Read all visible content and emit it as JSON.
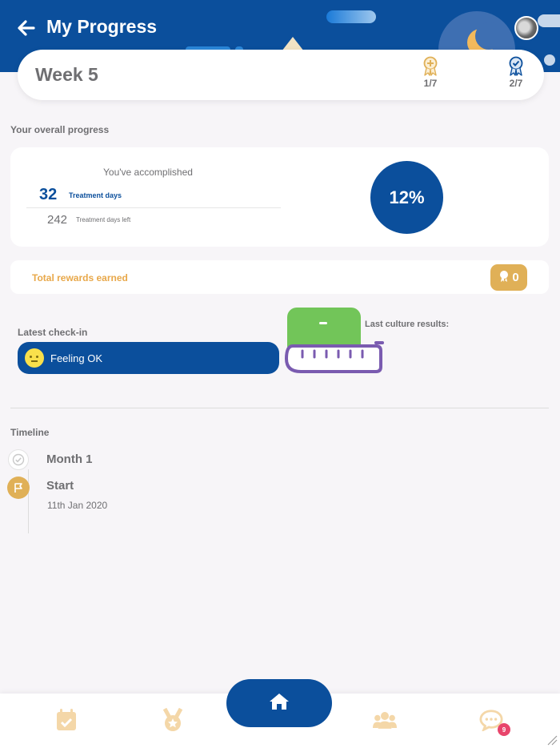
{
  "header": {
    "title": "My Progress"
  },
  "week": {
    "label": "Week 5",
    "badges": [
      {
        "icon": "award-ribbon-icon",
        "count": "1/7"
      },
      {
        "icon": "certificate-ribbon-icon",
        "count": "2/7"
      }
    ]
  },
  "overall": {
    "section_title": "Your overall progress",
    "accomplished_label": "You've accomplished",
    "treatment_days": "32",
    "treatment_days_label": "Treatment days",
    "days_left": "242",
    "days_left_label": "Treatment days left",
    "percent": "12%"
  },
  "rewards": {
    "label": "Total rewards earned",
    "count": "0"
  },
  "checkin": {
    "title": "Latest check-in",
    "status": "Feeling OK"
  },
  "culture": {
    "title": "Last culture results:"
  },
  "timeline": {
    "title": "Timeline",
    "items": [
      {
        "label": "Month 1",
        "icon": "check-icon"
      },
      {
        "label": "Start",
        "icon": "flag-icon",
        "date": "11th Jan 2020"
      }
    ]
  },
  "nav": {
    "items": [
      "calendar-check-icon",
      "medal-icon",
      "home-icon",
      "people-icon",
      "chat-icon"
    ],
    "chat_badge": "9"
  },
  "colors": {
    "primary": "#0b4f9c",
    "accent_gold": "#e0b057",
    "rewards_text": "#e8a84a",
    "culture_green": "#72c559",
    "tube_purple": "#7a5bb0",
    "badge_pink": "#e8456b"
  }
}
